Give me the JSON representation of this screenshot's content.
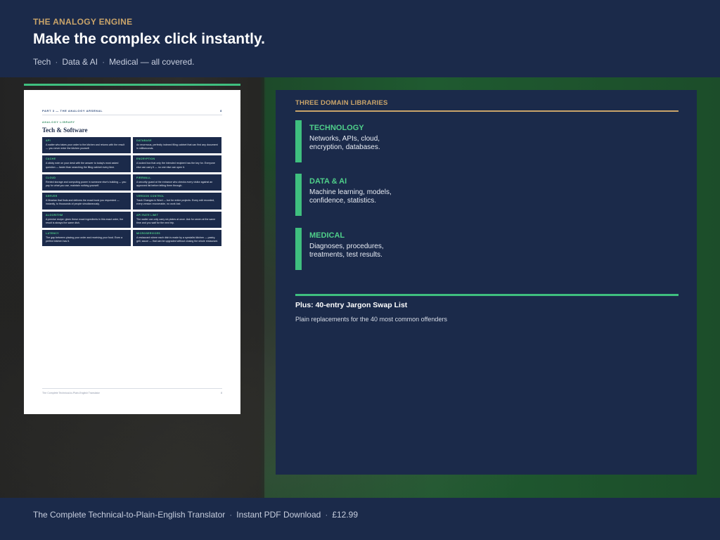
{
  "header": {
    "eyebrow": "THE ANALOGY ENGINE",
    "headline": "Make the complex click instantly.",
    "topics": [
      "Tech",
      "Data & AI",
      "Medical — all covered."
    ],
    "separator": "·"
  },
  "document": {
    "running_head": "PART 3 — THE ANALOGY ARSENAL",
    "page_number": "8",
    "kicker": "ANALOGY LIBRARY",
    "title": "Tech & Software",
    "cards": [
      {
        "term": "API",
        "analogy": "A waiter who takes your order to the kitchen and returns with the result — you never enter the kitchen yourself."
      },
      {
        "term": "DATABASE",
        "analogy": "An enormous, perfectly indexed filing cabinet that can find any document in milliseconds."
      },
      {
        "term": "CACHE",
        "analogy": "A sticky note on your desk with the answer to today's most asked question — faster than searching the filing cabinet every time."
      },
      {
        "term": "ENCRYPTION",
        "analogy": "A locked box that only the intended recipient has the key for. Everyone else can carry it — no one else can open it."
      },
      {
        "term": "CLOUD",
        "analogy": "Rented storage and computing power in someone else's building — you pay for what you use, maintain nothing yourself."
      },
      {
        "term": "FIREWALL",
        "analogy": "A security guard at the entrance who checks every visitor against an approved list before letting them through."
      },
      {
        "term": "SERVER",
        "analogy": "A librarian that finds and delivers the exact book you requested — instantly, to thousands of people simultaneously."
      },
      {
        "term": "VERSION CONTROL",
        "analogy": "Track Changes in Word — but for entire projects. Every edit recorded, every version recoverable, no work lost."
      },
      {
        "term": "ALGORITHM",
        "analogy": "A precise recipe: given these exact ingredients in this exact order, the result is always the same dish."
      },
      {
        "term": "API RATE LIMIT",
        "analogy": "The waiter can only carry six plates at once. Ask for seven at the same time and you wait for the next trip."
      },
      {
        "term": "LATENCY",
        "analogy": "The gap between placing your order and receiving your food. Even a perfect kitchen has it."
      },
      {
        "term": "MICROSERVICES",
        "analogy": "A restaurant where each dish is made by a specialist kitchen — pastry, grill, sauce — that can be upgraded without closing the whole restaurant."
      }
    ],
    "footer_title": "The Complete Technical-to-Plain-English Translator",
    "footer_page": "8"
  },
  "panel": {
    "label": "THREE DOMAIN LIBRARIES",
    "domains": [
      {
        "name": "TECHNOLOGY",
        "description": "Networks, APIs, cloud, encryption, databases."
      },
      {
        "name": "DATA & AI",
        "description": "Machine learning, models, confidence, statistics."
      },
      {
        "name": "MEDICAL",
        "description": "Diagnoses, procedures, treatments, test results."
      }
    ],
    "swap_title": "Plus: 40-entry Jargon Swap List",
    "swap_description": "Plain replacements for the 40 most common offenders"
  },
  "footer": {
    "items": [
      "The Complete Technical-to-Plain-English Translator",
      "Instant PDF Download",
      "£12.99"
    ],
    "separator": "·"
  },
  "colors": {
    "navy": "#1b2a4a",
    "gold": "#c9a46a",
    "green": "#3fbf7f"
  }
}
